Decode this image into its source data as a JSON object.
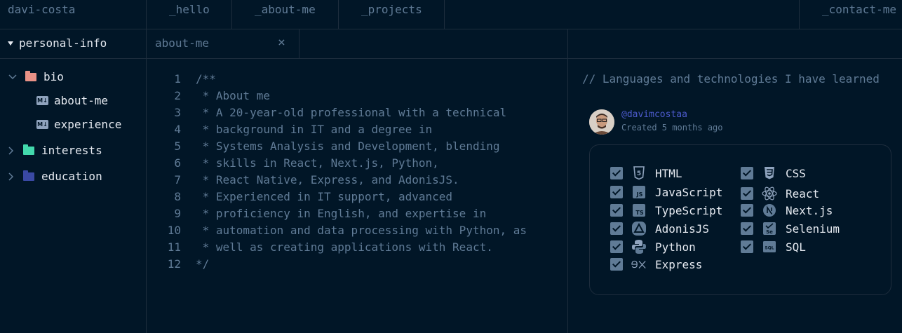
{
  "header": {
    "brand": "davi-costa",
    "tabs": [
      "_hello",
      "_about-me",
      "_projects"
    ],
    "contact": "_contact-me"
  },
  "sidebar": {
    "section": "personal-info",
    "items": [
      {
        "label": "bio",
        "color": "#e99287"
      },
      {
        "label": "about-me"
      },
      {
        "label": "experience"
      },
      {
        "label": "interests",
        "color": "#43d9ad"
      },
      {
        "label": "education",
        "color": "#3a49a4"
      }
    ]
  },
  "editor": {
    "tab": "about-me",
    "close": "×",
    "lines": [
      {
        "n": "1",
        "text": "/**"
      },
      {
        "n": "2",
        "text": " * About me"
      },
      {
        "n": "3",
        "text": " * A 20-year-old professional with a technical"
      },
      {
        "n": "4",
        "text": " * background in IT and a degree in"
      },
      {
        "n": "5",
        "text": " * Systems Analysis and Development, blending"
      },
      {
        "n": "6",
        "text": " * skills in React, Next.js, Python,"
      },
      {
        "n": "7",
        "text": " * React Native, Express, and AdonisJS."
      },
      {
        "n": "8",
        "text": " * Experienced in IT support, advanced"
      },
      {
        "n": "9",
        "text": " * proficiency in English, and expertise in"
      },
      {
        "n": "10",
        "text": " * automation and data processing with Python, as"
      },
      {
        "n": "11",
        "text": " * well as creating applications with React."
      },
      {
        "n": "12",
        "text": "*/"
      }
    ]
  },
  "panel": {
    "comment": "// Languages and technologies I have learned",
    "username": "@davimcostaa",
    "created": "Created 5 months ago",
    "technologies": [
      {
        "label": "HTML",
        "icon": "html5-icon"
      },
      {
        "label": "CSS",
        "icon": "css3-icon"
      },
      {
        "label": "JavaScript",
        "icon": "javascript-icon"
      },
      {
        "label": "React",
        "icon": "react-icon"
      },
      {
        "label": "TypeScript",
        "icon": "typescript-icon"
      },
      {
        "label": "Next.js",
        "icon": "nextjs-icon"
      },
      {
        "label": "AdonisJS",
        "icon": "adonisjs-icon"
      },
      {
        "label": "Selenium",
        "icon": "selenium-icon"
      },
      {
        "label": "Python",
        "icon": "python-icon"
      },
      {
        "label": "SQL",
        "icon": "sql-icon"
      },
      {
        "label": "Express",
        "icon": "express-icon"
      }
    ]
  },
  "colors": {
    "background": "#011627",
    "border": "#1e2d3d",
    "muted": "#607b96",
    "text": "#e5e9f0",
    "accent": "#4d5bce"
  }
}
